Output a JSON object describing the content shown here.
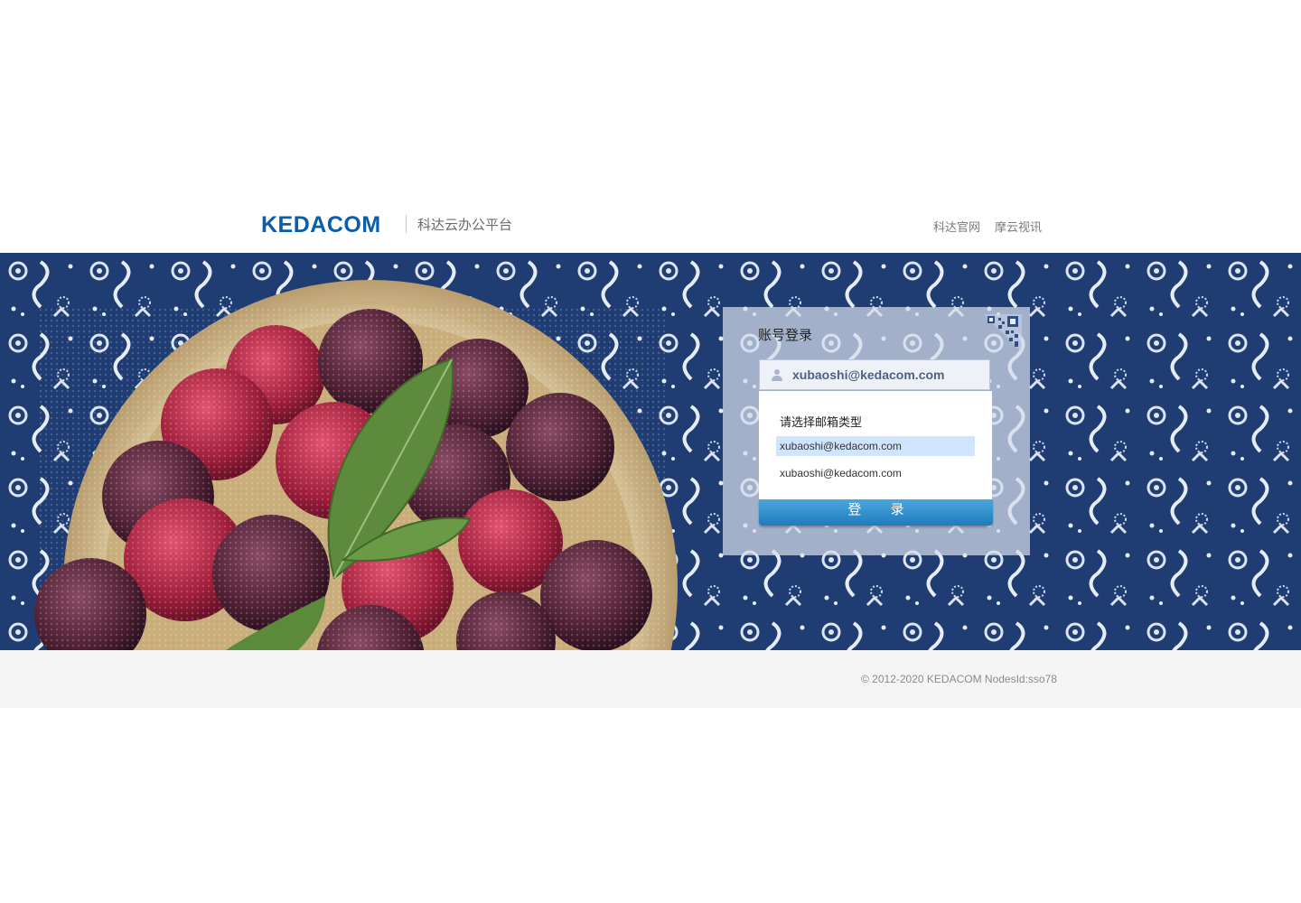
{
  "header": {
    "logo_text": "KEDACOM",
    "platform_name": "科达云办公平台",
    "nav": [
      "科达官网",
      "摩云视讯"
    ]
  },
  "login": {
    "title": "账号登录",
    "account_value": "xubaoshi@kedacom.com",
    "dropdown_title": "请选择邮箱类型",
    "options": [
      "xubaoshi@kedacom.com",
      "xubaoshi@kedacom.com"
    ],
    "selected_index": 0,
    "login_button": "登 录"
  },
  "footer": {
    "copyright": "© 2012-2020 KEDACOM NodesId:sso78"
  },
  "colors": {
    "brand": "#0a5da8",
    "banner_blue": "#1f3c73",
    "button": "#2a89c8"
  }
}
